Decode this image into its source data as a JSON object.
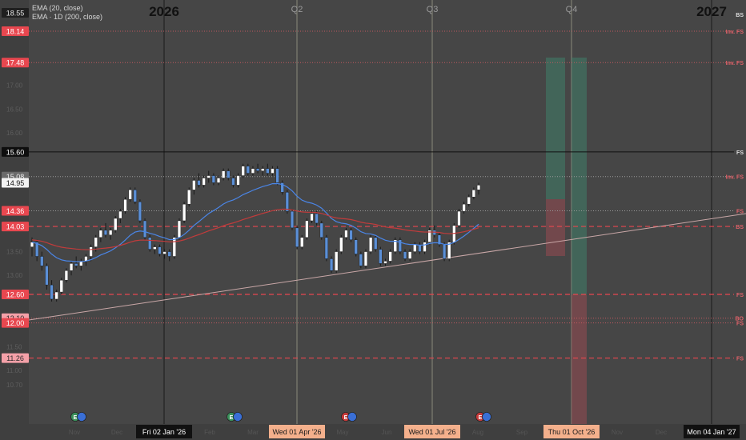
{
  "legend": {
    "ema20": "EMA (20, close)",
    "ema200": "EMA · 1D (200, close)"
  },
  "header_labels": [
    {
      "text": "2026",
      "style": "year"
    },
    {
      "text": "Q2",
      "style": "quarter"
    },
    {
      "text": "Q3",
      "style": "quarter"
    },
    {
      "text": "Q4",
      "style": "quarter"
    },
    {
      "text": "2027",
      "style": "year"
    }
  ],
  "bottom_labels": [
    {
      "text": "Fri 02 Jan '26",
      "style": "dark"
    },
    {
      "text": "Wed 01 Apr '26",
      "style": "orange"
    },
    {
      "text": "Wed 01 Jul '26",
      "style": "orange"
    },
    {
      "text": "Thu 01 Oct '26",
      "style": "orange"
    },
    {
      "text": "Mon 04 Jan '27",
      "style": "dark"
    }
  ],
  "earnings_markers": [
    "E",
    "E",
    "E",
    "E"
  ],
  "colors": {
    "background": "#464646",
    "candle_up": "#ffffff",
    "candle_down": "#5b8fd6",
    "ema20": "#4a86e8",
    "ema200": "#c23b3b",
    "level_red": "#e8474f",
    "trendline": "#c9a7a7"
  },
  "chart_data": {
    "type": "candlestick",
    "y_axis_labels": [
      {
        "value": "18.55",
        "style": "dark"
      },
      {
        "value": "18.14",
        "style": "red"
      },
      {
        "value": "17.48",
        "style": "red"
      },
      {
        "value": "15.60",
        "style": "black"
      },
      {
        "value": "15.08",
        "style": "gray"
      },
      {
        "value": "14.95",
        "style": "white"
      },
      {
        "value": "14.36",
        "style": "red"
      },
      {
        "value": "14.03",
        "style": "red"
      },
      {
        "value": "12.60",
        "style": "red"
      },
      {
        "value": "12.10",
        "style": "pink"
      },
      {
        "value": "12.00",
        "style": "red"
      },
      {
        "value": "11.26",
        "style": "pink"
      }
    ],
    "levels": [
      {
        "value": 18.14,
        "label": "Inv. FS",
        "style": "dotted-red"
      },
      {
        "value": 17.48,
        "label": "Inv. FS",
        "style": "dotted-red"
      },
      {
        "value": 15.6,
        "label": "FS",
        "style": "solid-black"
      },
      {
        "value": 15.08,
        "label": "Inv. FS",
        "style": "dotted-gray"
      },
      {
        "value": 14.36,
        "label": "FS",
        "style": "dotted-gray"
      },
      {
        "value": 14.03,
        "label": "BS",
        "style": "dashed-red"
      },
      {
        "value": 12.6,
        "label": "FS",
        "style": "dashed-red"
      },
      {
        "value": 12.1,
        "label": "BO",
        "style": "dotted-red"
      },
      {
        "value": 12.0,
        "label": "FS",
        "style": "dotted-red"
      },
      {
        "value": 11.26,
        "label": "FS",
        "style": "dashed-red"
      }
    ],
    "top_right_label": "BS",
    "candles": [
      [
        13.6,
        13.8,
        13.4,
        13.7
      ],
      [
        13.7,
        13.75,
        13.3,
        13.4
      ],
      [
        13.4,
        13.5,
        13.1,
        13.2
      ],
      [
        13.2,
        13.25,
        12.7,
        12.8
      ],
      [
        12.8,
        12.9,
        12.45,
        12.5
      ],
      [
        12.5,
        12.7,
        12.45,
        12.65
      ],
      [
        12.65,
        12.95,
        12.6,
        12.9
      ],
      [
        12.9,
        13.15,
        12.85,
        13.1
      ],
      [
        13.1,
        13.3,
        13.0,
        13.25
      ],
      [
        13.25,
        13.4,
        13.15,
        13.2
      ],
      [
        13.2,
        13.35,
        13.1,
        13.3
      ],
      [
        13.3,
        13.45,
        13.2,
        13.4
      ],
      [
        13.4,
        13.65,
        13.3,
        13.6
      ],
      [
        13.6,
        13.85,
        13.5,
        13.8
      ],
      [
        13.8,
        14.0,
        13.7,
        13.95
      ],
      [
        13.95,
        14.1,
        13.8,
        13.85
      ],
      [
        13.85,
        14.0,
        13.75,
        13.95
      ],
      [
        13.95,
        14.25,
        13.9,
        14.2
      ],
      [
        14.2,
        14.4,
        14.1,
        14.35
      ],
      [
        14.35,
        14.65,
        14.3,
        14.6
      ],
      [
        14.6,
        14.85,
        14.55,
        14.8
      ],
      [
        14.8,
        14.85,
        14.5,
        14.55
      ],
      [
        14.55,
        14.6,
        14.1,
        14.15
      ],
      [
        14.15,
        14.2,
        13.75,
        13.8
      ],
      [
        13.8,
        13.85,
        13.5,
        13.55
      ],
      [
        13.55,
        13.65,
        13.45,
        13.6
      ],
      [
        13.6,
        13.65,
        13.4,
        13.45
      ],
      [
        13.45,
        13.55,
        13.35,
        13.5
      ],
      [
        13.5,
        13.55,
        13.3,
        13.4
      ],
      [
        13.4,
        13.85,
        13.35,
        13.8
      ],
      [
        13.8,
        14.2,
        13.75,
        14.15
      ],
      [
        14.15,
        14.55,
        14.1,
        14.5
      ],
      [
        14.5,
        14.85,
        14.45,
        14.8
      ],
      [
        14.8,
        15.05,
        14.7,
        15.0
      ],
      [
        15.0,
        15.15,
        14.85,
        14.9
      ],
      [
        14.9,
        15.1,
        14.85,
        15.05
      ],
      [
        15.05,
        15.2,
        14.95,
        15.1
      ],
      [
        15.1,
        15.15,
        14.9,
        14.95
      ],
      [
        14.95,
        15.1,
        14.9,
        15.05
      ],
      [
        15.05,
        15.25,
        15.0,
        15.2
      ],
      [
        15.2,
        15.25,
        15.0,
        15.05
      ],
      [
        15.05,
        15.1,
        14.85,
        14.9
      ],
      [
        14.9,
        15.15,
        14.85,
        15.1
      ],
      [
        15.1,
        15.35,
        15.05,
        15.3
      ],
      [
        15.3,
        15.35,
        15.1,
        15.15
      ],
      [
        15.15,
        15.3,
        15.1,
        15.25
      ],
      [
        15.25,
        15.35,
        15.15,
        15.2
      ],
      [
        15.2,
        15.3,
        15.1,
        15.25
      ],
      [
        15.25,
        15.35,
        15.1,
        15.15
      ],
      [
        15.15,
        15.3,
        15.1,
        15.25
      ],
      [
        15.25,
        15.3,
        14.9,
        14.95
      ],
      [
        14.95,
        15.0,
        14.7,
        14.75
      ],
      [
        14.75,
        14.8,
        14.3,
        14.35
      ],
      [
        14.35,
        14.4,
        13.95,
        14.0
      ],
      [
        14.0,
        14.05,
        13.55,
        13.6
      ],
      [
        13.6,
        13.85,
        13.55,
        13.8
      ],
      [
        13.8,
        14.2,
        13.75,
        14.15
      ],
      [
        14.15,
        14.35,
        14.1,
        14.3
      ],
      [
        14.3,
        14.35,
        14.05,
        14.1
      ],
      [
        14.1,
        14.15,
        13.75,
        13.8
      ],
      [
        13.8,
        13.85,
        13.3,
        13.35
      ],
      [
        13.35,
        13.4,
        13.05,
        13.1
      ],
      [
        13.1,
        13.55,
        13.05,
        13.5
      ],
      [
        13.5,
        13.85,
        13.45,
        13.8
      ],
      [
        13.8,
        14.0,
        13.75,
        13.95
      ],
      [
        13.95,
        14.0,
        13.7,
        13.75
      ],
      [
        13.75,
        13.8,
        13.4,
        13.45
      ],
      [
        13.45,
        13.5,
        13.15,
        13.2
      ],
      [
        13.2,
        13.55,
        13.15,
        13.5
      ],
      [
        13.5,
        13.85,
        13.45,
        13.8
      ],
      [
        13.8,
        13.85,
        13.5,
        13.55
      ],
      [
        13.55,
        13.6,
        13.2,
        13.25
      ],
      [
        13.25,
        13.35,
        13.2,
        13.3
      ],
      [
        13.3,
        13.55,
        13.25,
        13.5
      ],
      [
        13.5,
        13.8,
        13.45,
        13.75
      ],
      [
        13.75,
        13.8,
        13.45,
        13.5
      ],
      [
        13.5,
        13.55,
        13.3,
        13.35
      ],
      [
        13.35,
        13.55,
        13.3,
        13.5
      ],
      [
        13.5,
        13.7,
        13.45,
        13.65
      ],
      [
        13.65,
        13.7,
        13.45,
        13.5
      ],
      [
        13.5,
        13.75,
        13.45,
        13.7
      ],
      [
        13.7,
        14.0,
        13.65,
        13.95
      ],
      [
        13.95,
        14.05,
        13.8,
        13.85
      ],
      [
        13.85,
        13.9,
        13.6,
        13.65
      ],
      [
        13.65,
        13.7,
        13.3,
        13.35
      ],
      [
        13.35,
        13.75,
        13.3,
        13.7
      ],
      [
        13.7,
        14.1,
        13.65,
        14.05
      ],
      [
        14.05,
        14.4,
        14.0,
        14.35
      ],
      [
        14.35,
        14.55,
        14.3,
        14.5
      ],
      [
        14.5,
        14.7,
        14.45,
        14.65
      ],
      [
        14.65,
        14.85,
        14.6,
        14.8
      ],
      [
        14.8,
        14.95,
        14.7,
        14.9
      ]
    ]
  }
}
